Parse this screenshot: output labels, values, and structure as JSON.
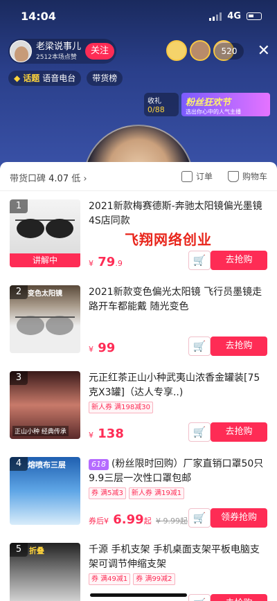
{
  "status": {
    "time": "14:04",
    "network": "4G"
  },
  "host": {
    "name": "老梁说事儿",
    "likes": "2512本场点赞",
    "follow_label": "关注"
  },
  "viewers": {
    "count": "520"
  },
  "tags": [
    {
      "prefix": "话题",
      "label": "语音电台"
    },
    {
      "label": "带货榜"
    }
  ],
  "gift": {
    "label": "收礼",
    "progress": "0/88"
  },
  "banner": {
    "title": "粉丝狂欢节",
    "subtitle": "选出你心中的人气主播"
  },
  "sheet": {
    "reputation_label": "带货口碑",
    "reputation_value": "4.07",
    "reputation_level": "低",
    "orders_label": "订单",
    "cart_label": "购物车"
  },
  "watermark": "飞翔网络创业",
  "products": [
    {
      "index": "1",
      "title": "2021新款梅赛德斯-奔驰太阳镜偏光墨镜 4S店同款",
      "price": "79",
      "price_dec": ".9",
      "currency": "¥",
      "live_label": "讲解中",
      "buy_label": "去抢购",
      "coupons": []
    },
    {
      "index": "2",
      "title": "2021新款变色偏光太阳镜 飞行员墨镜走路开车都能戴 随光变色",
      "price": "99",
      "currency": "¥",
      "buy_label": "去抢购",
      "coupons": [],
      "thumb_text": "变色太阳镜"
    },
    {
      "index": "3",
      "title": "元正红茶正山小种武夷山浓香金罐装[75克X3罐]（达人专享..)",
      "price": "138",
      "currency": "¥",
      "buy_label": "去抢购",
      "coupons": [
        "新人券 满198减30"
      ],
      "thumb_text": "正山小种 经典传承"
    },
    {
      "index": "4",
      "badge": "618",
      "title": "(粉丝限时回购）厂家直销口罩50只9.9三层一次性口罩包邮",
      "price_prefix": "券后",
      "price": "6.99",
      "price_suffix": "起",
      "orig_price": "¥ 9.99起",
      "currency": "¥",
      "buy_label": "领券抢购",
      "coupons": [
        "券 满5减3",
        "新人券 满19减1"
      ],
      "thumb_text": "熔喷布三层"
    },
    {
      "index": "5",
      "title": "千源 手机支架 手机桌面支架平板电脑支架可调节伸缩支架",
      "price": "",
      "currency": "¥",
      "buy_label": "去抢购",
      "coupons": [
        "券 满49减1",
        "券 满99减2"
      ],
      "thumb_text": "折叠"
    }
  ]
}
